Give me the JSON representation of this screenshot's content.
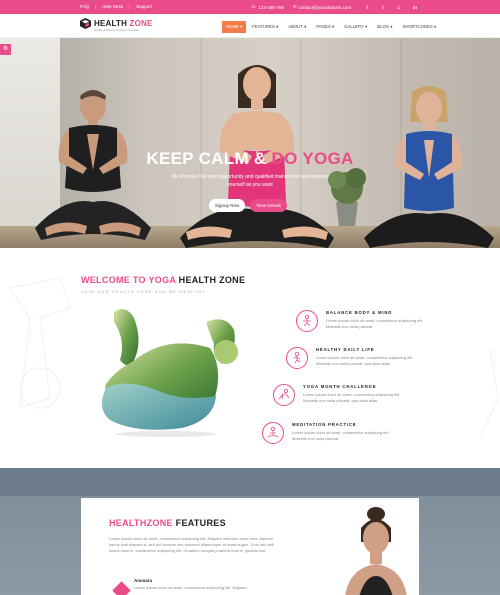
{
  "topbar": {
    "links": [
      "FAQ",
      "Help Desk",
      "Support"
    ],
    "phone": "123-456-789",
    "email": "contact@yourdomain.com",
    "social_icons": [
      "facebook-icon",
      "twitter-icon",
      "instagram-icon",
      "linkedin-icon"
    ]
  },
  "brand": {
    "name_part1": "HEALTH",
    "name_part2": "ZONE",
    "tagline": "Health & Beauty Fitness Template"
  },
  "nav": {
    "items": [
      "HOME",
      "FEATURES",
      "ABOUT",
      "PAGES",
      "GALLERY",
      "BLOG",
      "SHORTCODES"
    ],
    "active": "HOME"
  },
  "hero": {
    "title_white": "KEEP CALM & ",
    "title_pink": "DO YOGA",
    "subtitle": "We Provide Our best opportunity and qualified trainers for best workout yourself as you want",
    "btn_signup": "Signup Now",
    "btn_details": "View Details",
    "slides": 3,
    "active_slide": 1
  },
  "welcome": {
    "title_pink": "WELCOME TO YOGA",
    "title_dark": " HEALTH ZONE",
    "subtitle": "JOIN OUR HEALTH ZONE AND BE HEALTHY.",
    "features": [
      {
        "title": "BALANCE BODY & MIND",
        "text": "Lorem ipsum dolor sit amet, consectetur adipiscing elit. Molestie non nulla placeat."
      },
      {
        "title": "HEALTHY DAILY LIFE",
        "text": "Lorem ipsum dolor sit amet, consectetur adipiscing elit. Molestie non nulla placeat, quo dicta alias."
      },
      {
        "title": "YOGA MONTH CHALLENGE",
        "text": "Lorem ipsum dolor sit amet, consectetur adipiscing elit. Molestie non nulla placeat, quo dicta alias."
      },
      {
        "title": "MEDITATION PRACTICE",
        "text": "Lorem ipsum dolor sit amet, consectetur adipiscing elit. Molestie non nulla placeat."
      }
    ]
  },
  "features_section": {
    "title_pink": "HEALTHZONE",
    "title_dark": " FEATURES",
    "paragraph": "Lorem ipsum dolor sit amet, consectetur adipiscing elit. Aliquam interdum dolor eros. Aenean varius erat aliquam a, sed dui Aenean nec euismod ullamcorper et amet augue. Duis nisi velit luctus risus in, consectetur adipiscing elit. Curabitur congue pharetra eros a, gravida nisl.",
    "item_title": "Anusara",
    "item_text": "Lorem ipsum dolor sit amet, consectetur adipiscing elit. Aliquam"
  },
  "colors": {
    "accent": "#ea4c89",
    "nav_active": "#f47c4a"
  }
}
